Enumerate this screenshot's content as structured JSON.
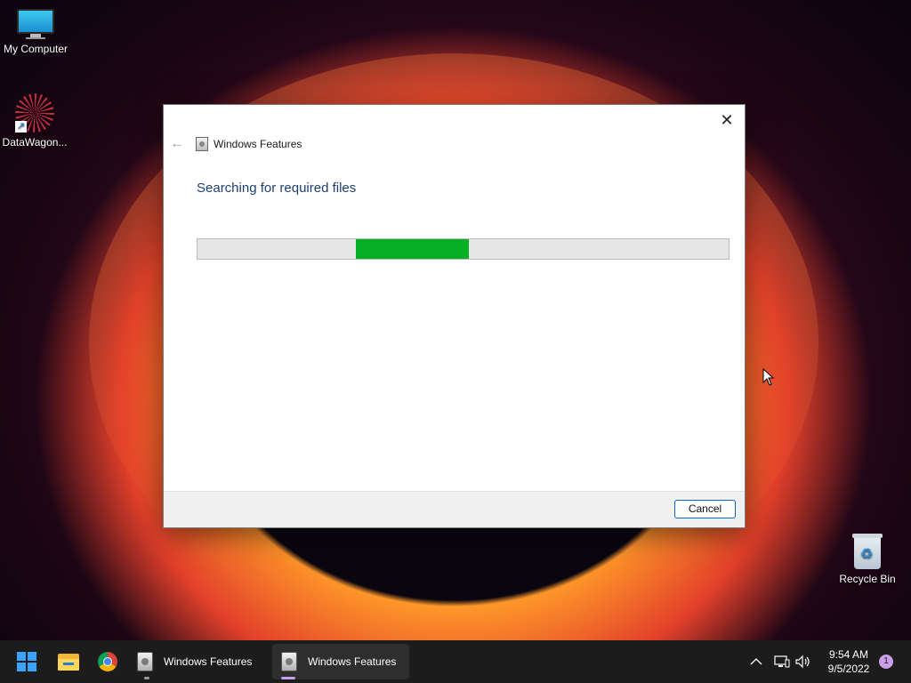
{
  "desktop": {
    "icons": [
      {
        "label": "My Computer"
      },
      {
        "label": "DataWagon..."
      },
      {
        "label": "Recycle Bin"
      }
    ]
  },
  "dialog": {
    "title": "Windows Features",
    "heading": "Searching for required files",
    "progress_state": "indeterminate (marquee)",
    "cancel_label": "Cancel",
    "close_glyph": "✕",
    "back_glyph": "←"
  },
  "taskbar": {
    "apps": [
      {
        "name": "start",
        "icon": "windows-logo-icon"
      },
      {
        "name": "file-explorer",
        "icon": "folder-icon"
      },
      {
        "name": "chrome",
        "icon": "chrome-icon"
      },
      {
        "name": "windows-features-1",
        "label": "Windows Features"
      },
      {
        "name": "windows-features-2",
        "label": "Windows Features",
        "active": true
      }
    ],
    "tray": {
      "chevron": "^",
      "time": "9:54 AM",
      "date": "9/5/2022",
      "notification_count": "1"
    }
  },
  "colors": {
    "progress_fill": "#06b025",
    "heading": "#1e3f74",
    "accent": "#0067c0",
    "taskbar": "#1c1c1c"
  }
}
